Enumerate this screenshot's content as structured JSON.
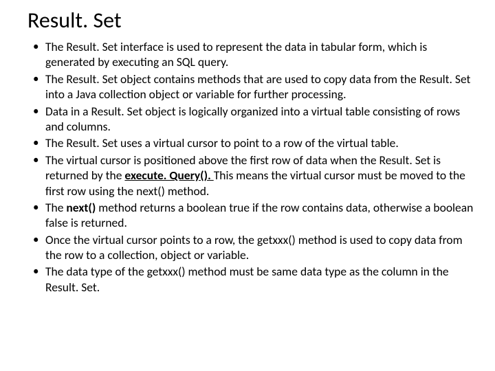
{
  "title": "Result. Set",
  "bullets": [
    {
      "pre": "The Result. Set interface is used to represent the data in tabular form, which is generated by executing an SQL query."
    },
    {
      "pre": "The Result. Set object contains methods that are used to copy data from the Result. Set into a Java collection object or variable for further processing."
    },
    {
      "pre": "Data in a Result. Set object is logically organized into a virtual table consisting of rows and columns."
    },
    {
      "pre": "The Result. Set uses a virtual cursor to point to a row of the virtual table."
    },
    {
      "pre": "The virtual cursor is positioned above the first row of data when the Result. Set is returned by the ",
      "boldUnder": "execute. Query(). ",
      "post": "This means the virtual cursor must be moved to the first row using the next() method."
    },
    {
      "pre": "The ",
      "bold": "next() ",
      "post": "method returns a boolean true if the row contains data, otherwise a boolean false is returned."
    },
    {
      "pre": "Once the virtual cursor points to a row, the getxxx() method is used to copy data from the row to a collection, object or  variable."
    },
    {
      "pre": "The data type of the getxxx() method must be same data type as the column in the Result. Set."
    }
  ]
}
